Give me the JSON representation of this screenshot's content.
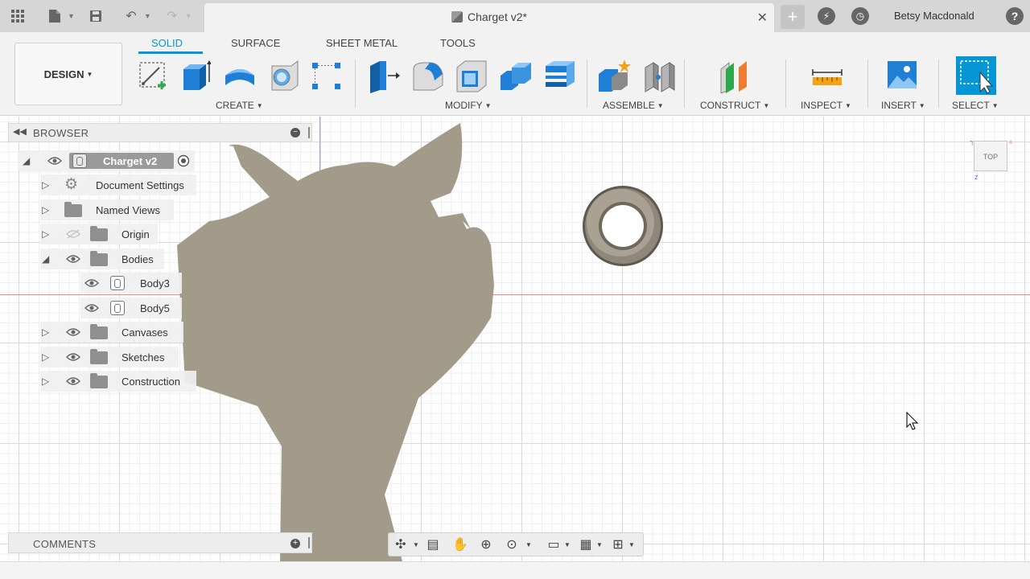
{
  "window": {
    "document_title": "Charget v2*",
    "user_name": "Betsy Macdonald"
  },
  "workspace": {
    "mode_label": "DESIGN"
  },
  "tabs": [
    {
      "label": "SOLID",
      "active": true
    },
    {
      "label": "SURFACE",
      "active": false
    },
    {
      "label": "SHEET METAL",
      "active": false
    },
    {
      "label": "TOOLS",
      "active": false
    }
  ],
  "tool_groups": {
    "create": "CREATE",
    "modify": "MODIFY",
    "assemble": "ASSEMBLE",
    "construct": "CONSTRUCT",
    "inspect": "INSPECT",
    "insert": "INSERT",
    "select": "SELECT"
  },
  "browser": {
    "title": "BROWSER",
    "root": "Charget v2",
    "items": [
      {
        "label": "Document Settings"
      },
      {
        "label": "Named Views"
      },
      {
        "label": "Origin"
      },
      {
        "label": "Bodies"
      },
      {
        "label": "Body3"
      },
      {
        "label": "Body5"
      },
      {
        "label": "Canvases"
      },
      {
        "label": "Sketches"
      },
      {
        "label": "Construction"
      }
    ]
  },
  "viewcube": {
    "face": "TOP"
  },
  "comments": {
    "title": "COMMENTS"
  },
  "colors": {
    "accent": "#0696d7",
    "shape_fill": "#a39b8a",
    "axis_red": "#e58a8a"
  }
}
